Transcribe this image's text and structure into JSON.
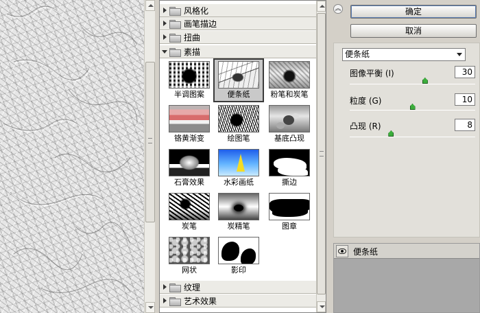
{
  "buttons": {
    "ok": "确定",
    "cancel": "取消"
  },
  "categories_top": [
    {
      "label": "风格化",
      "expanded": false
    },
    {
      "label": "画笔描边",
      "expanded": false
    },
    {
      "label": "扭曲",
      "expanded": false
    },
    {
      "label": "素描",
      "expanded": true
    }
  ],
  "categories_bottom": [
    {
      "label": "纹理",
      "expanded": false
    },
    {
      "label": "艺术效果",
      "expanded": false
    }
  ],
  "sketch_filters": [
    {
      "label": "半调图案",
      "selected": false
    },
    {
      "label": "便条纸",
      "selected": true
    },
    {
      "label": "粉笔和炭笔",
      "selected": false
    },
    {
      "label": "铬黄渐变",
      "selected": false
    },
    {
      "label": "绘图笔",
      "selected": false
    },
    {
      "label": "基底凸现",
      "selected": false
    },
    {
      "label": "石膏效果",
      "selected": false
    },
    {
      "label": "水彩画纸",
      "selected": false
    },
    {
      "label": "撕边",
      "selected": false
    },
    {
      "label": "炭笔",
      "selected": false
    },
    {
      "label": "炭精笔",
      "selected": false
    },
    {
      "label": "图章",
      "selected": false
    },
    {
      "label": "网状",
      "selected": false
    },
    {
      "label": "影印",
      "selected": false
    }
  ],
  "settings": {
    "filter_select": "便条纸",
    "params": [
      {
        "label": "图像平衡 (I)",
        "value": "30",
        "fraction": 0.6
      },
      {
        "label": "粒度 (G)",
        "value": "10",
        "fraction": 0.5
      },
      {
        "label": "凸现 (R)",
        "value": "8",
        "fraction": 0.33
      }
    ]
  },
  "layer": {
    "name": "便条纸"
  },
  "icons": {
    "collapse": "double-chevron-up-icon",
    "eye": "eye-icon",
    "folder": "folder-icon"
  }
}
